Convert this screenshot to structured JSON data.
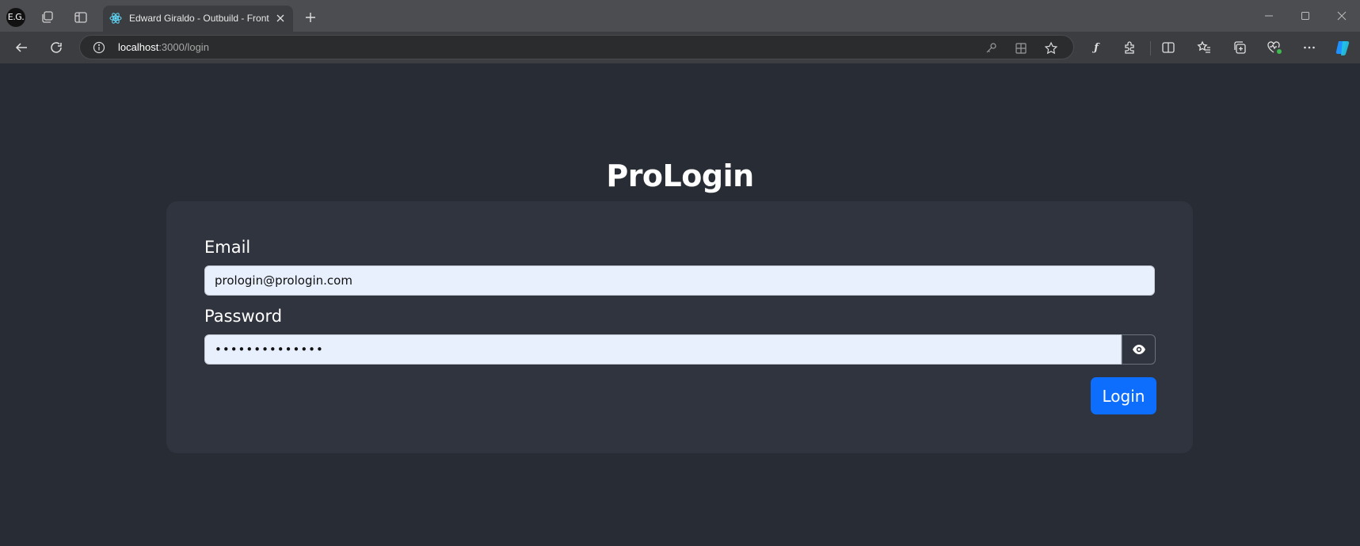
{
  "browser": {
    "profile_initials": "E.G.",
    "tab": {
      "title": "Edward Giraldo - Outbuild - Front"
    },
    "address": {
      "host": "localhost",
      "path": ":3000/login"
    }
  },
  "page": {
    "title": "ProLogin",
    "form": {
      "email_label": "Email",
      "email_value": "prologin@prologin.com",
      "password_label": "Password",
      "password_value": "••••••••••••••",
      "submit_label": "Login"
    }
  },
  "colors": {
    "accent": "#0d6efd",
    "page_bg": "#282c34",
    "card_bg": "#30343e",
    "input_bg": "#e8f0fe"
  }
}
